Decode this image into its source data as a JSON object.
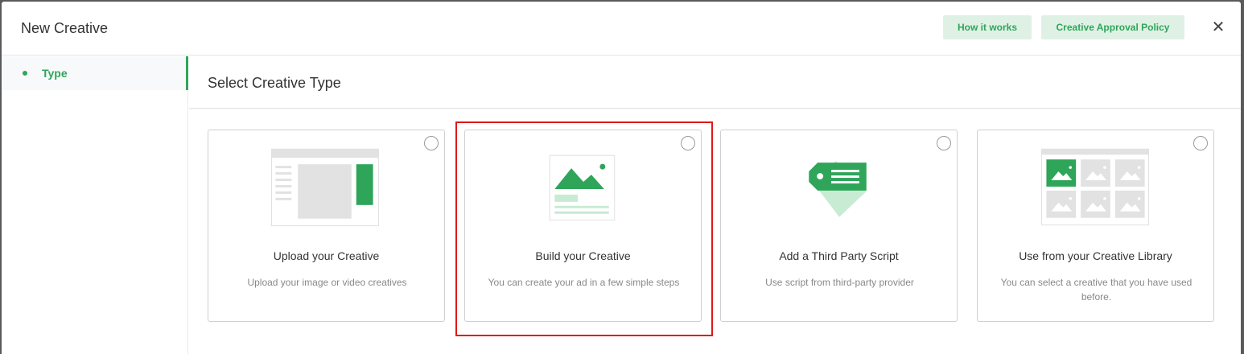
{
  "header": {
    "title": "New Creative",
    "how_it_works": "How it works",
    "approval_policy": "Creative Approval Policy",
    "close_glyph": "✕"
  },
  "sidebar": {
    "items": [
      {
        "label": "Type",
        "active": true
      }
    ]
  },
  "main": {
    "title": "Select Creative Type",
    "cards": [
      {
        "title": "Upload your Creative",
        "desc": "Upload your image or video creatives",
        "icon": "upload-layout-icon",
        "selected": false
      },
      {
        "title": "Build your Creative",
        "desc": "You can create your ad in a few simple steps",
        "icon": "build-image-icon",
        "selected": false
      },
      {
        "title": "Add a Third Party Script",
        "desc": "Use script from third-party provider",
        "icon": "tag-icon",
        "selected": false
      },
      {
        "title": "Use from your Creative Library",
        "desc": "You can select a creative that you have used before.",
        "icon": "library-grid-icon",
        "selected": false
      }
    ]
  },
  "colors": {
    "accent": "#2fa55a",
    "accent_light": "#dff1e5",
    "highlight": "#e01818"
  }
}
